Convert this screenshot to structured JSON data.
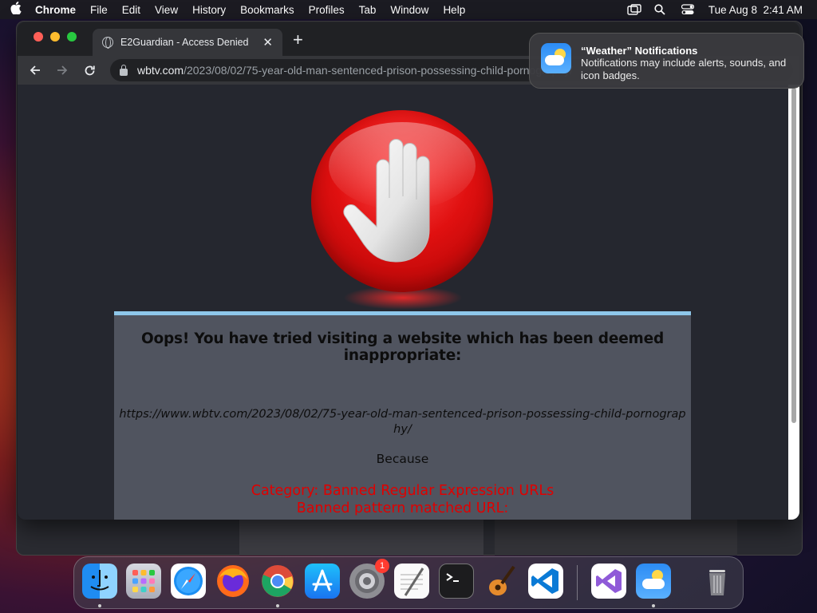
{
  "menubar": {
    "app_name": "Chrome",
    "items": [
      "File",
      "Edit",
      "View",
      "History",
      "Bookmarks",
      "Profiles",
      "Tab",
      "Window",
      "Help"
    ],
    "clock": "Tue Aug 8  2:41 AM"
  },
  "browser": {
    "tab_title": "E2Guardian - Access Denied",
    "url_host": "wbtv.com",
    "url_path": "/2023/08/02/75-year-old-man-sentenced-prison-possessing-child-pornography/"
  },
  "blockpage": {
    "heading": "Oops! You have tried visiting a website which has been deemed inappropriate:",
    "blocked_url": "https://www.wbtv.com/2023/08/02/75-year-old-man-sentenced-prison-possessing-child-pornography/",
    "because": "Because",
    "category_line": "Category: Banned Regular Expression URLs",
    "reason_line": "Banned pattern matched URL:"
  },
  "notification": {
    "title": "“Weather” Notifications",
    "body": "Notifications may include alerts, sounds, and icon badges."
  },
  "dock": {
    "apps": [
      "finder",
      "launchpad",
      "safari",
      "firefox",
      "chrome",
      "app-store",
      "system-settings",
      "textedit",
      "terminal",
      "garageband",
      "vscode",
      "visual-studio",
      "weather",
      "trash"
    ],
    "system_settings_badge": "1"
  },
  "colors": {
    "block_red": "#e00000",
    "accent_blue": "#8ec7ea",
    "chrome_dark": "#202124"
  }
}
